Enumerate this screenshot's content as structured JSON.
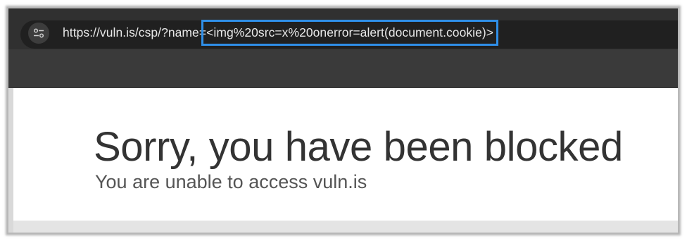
{
  "browser": {
    "url_prefix": "https://vuln.is/csp/?name=",
    "url_highlighted": "<img%20src=x%20onerror=alert(document.cookie)>",
    "site_info_icon": "site-settings-icon",
    "highlight_color": "#2f8fe8"
  },
  "page": {
    "title": "Sorry, you have been blocked",
    "subtitle": "You are unable to access vuln.is"
  }
}
